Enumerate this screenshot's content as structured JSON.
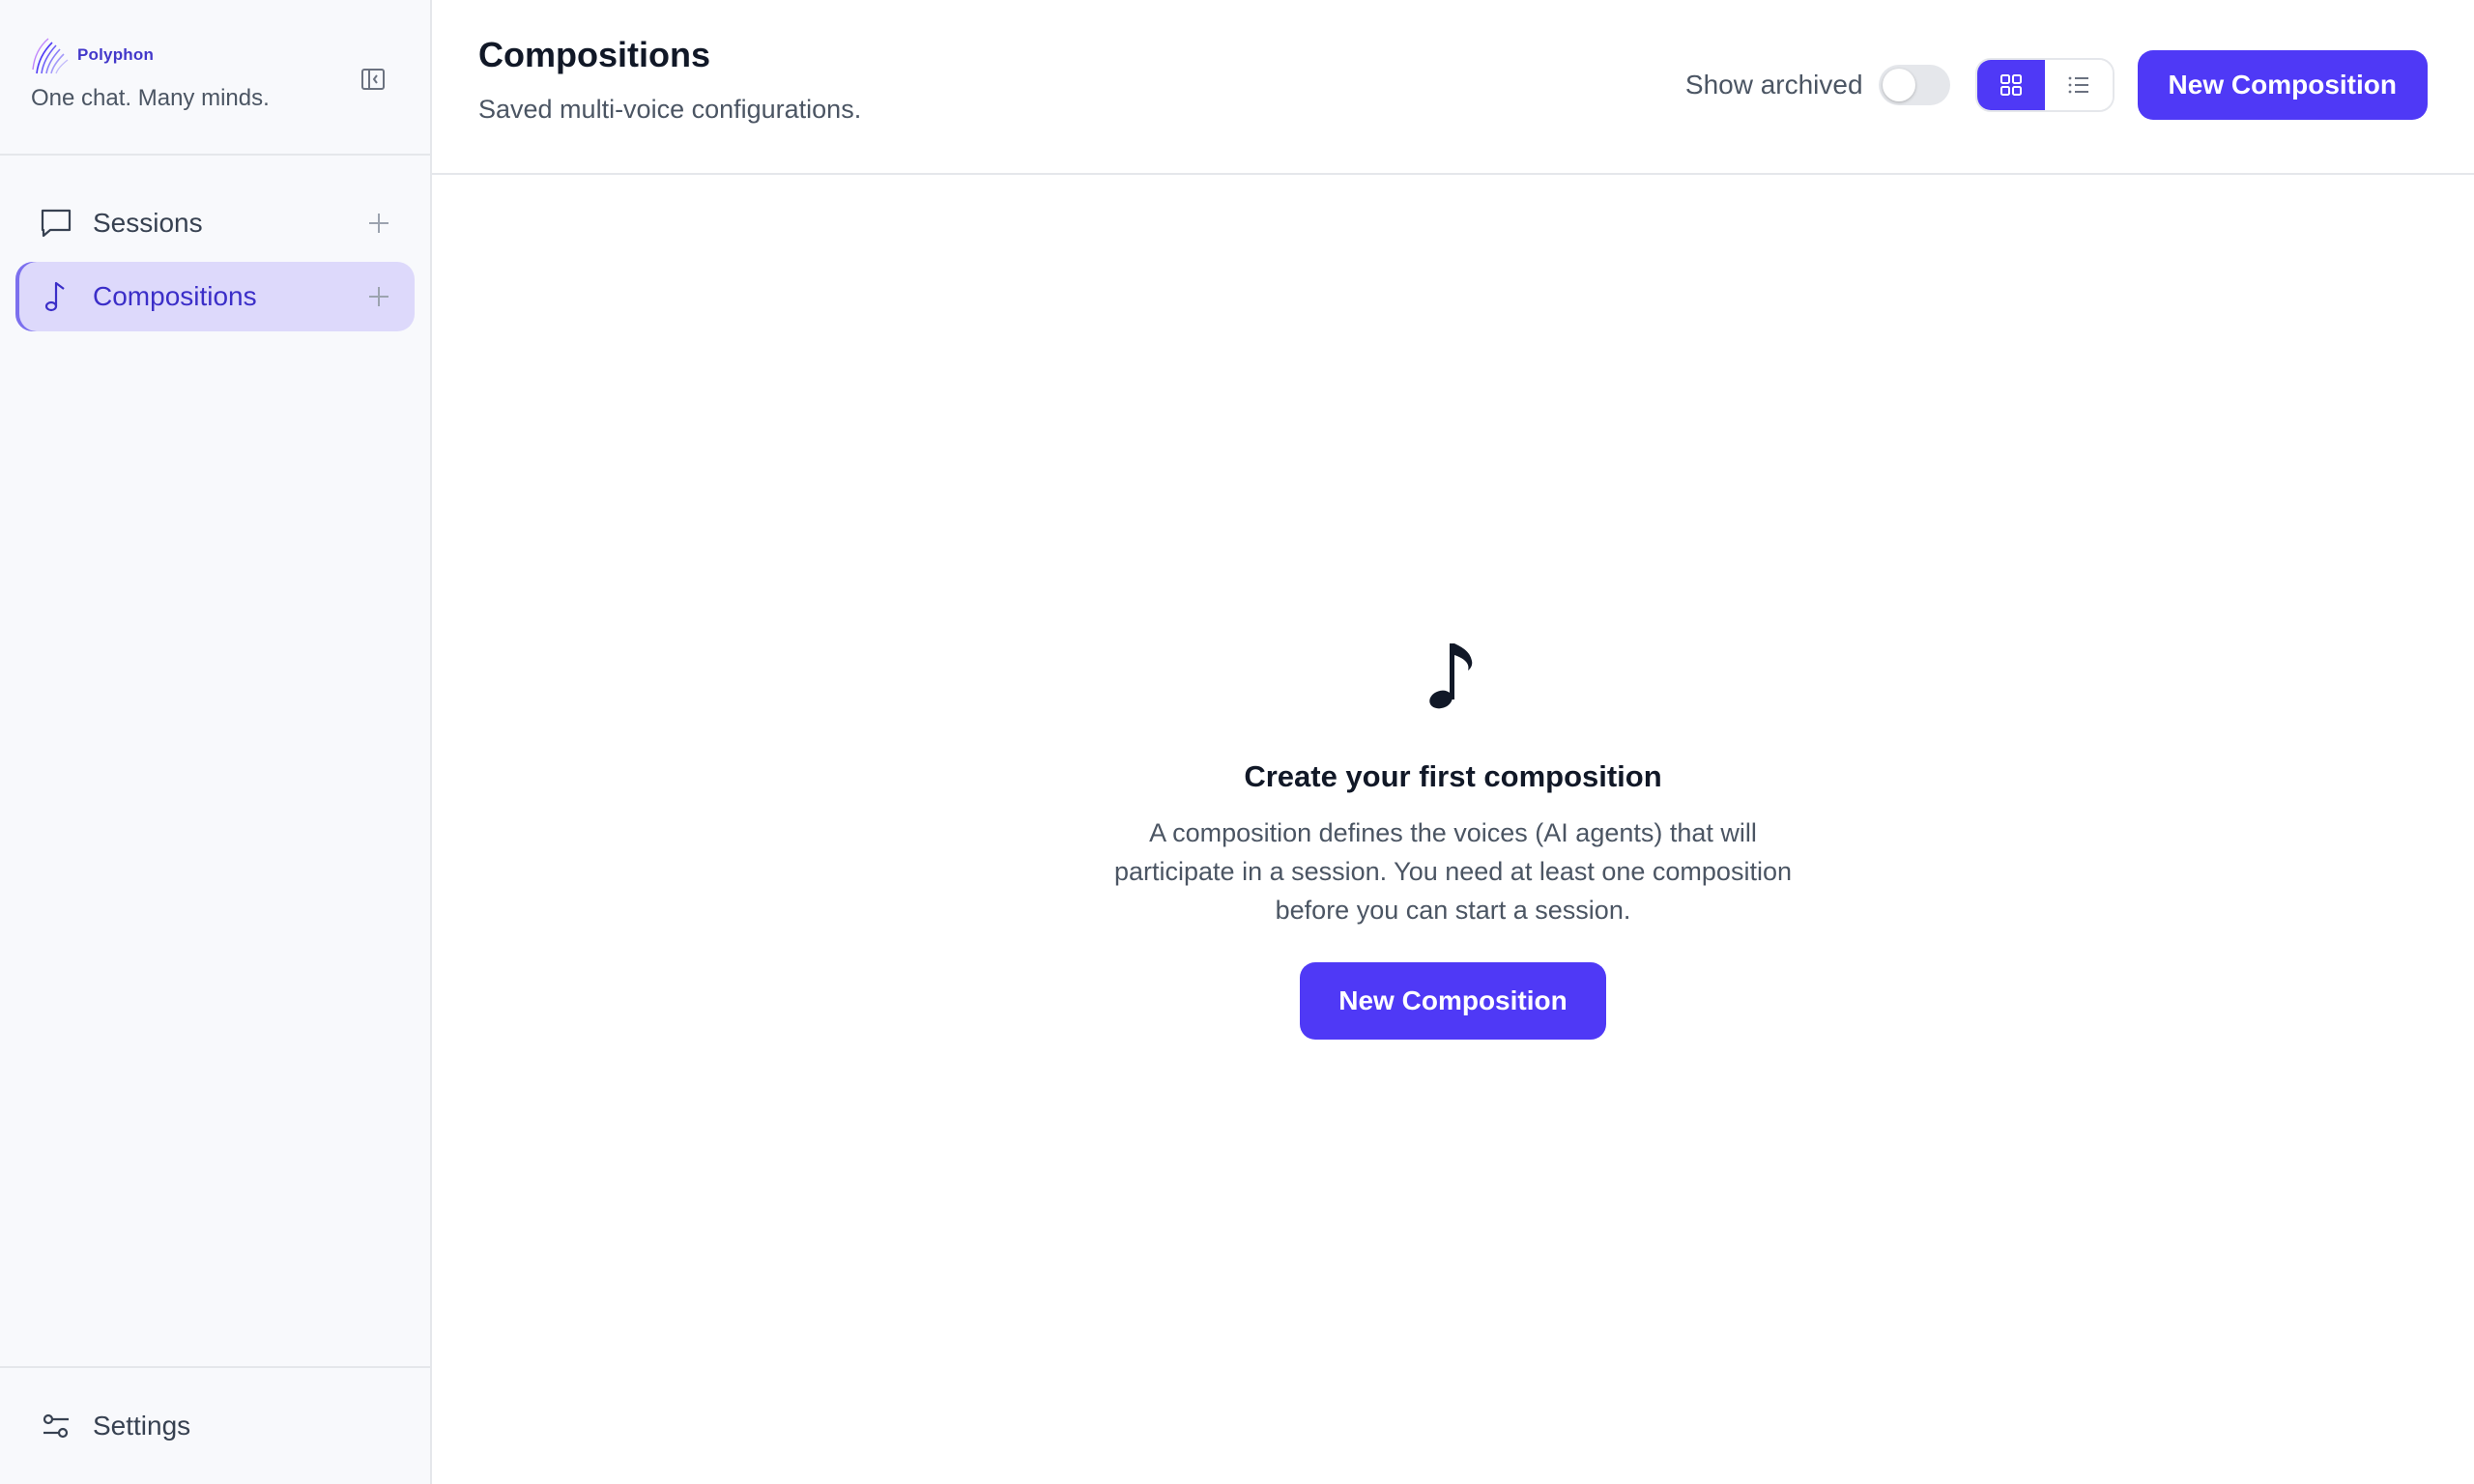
{
  "brand": {
    "name": "Polyphon",
    "tagline": "One chat. Many minds.",
    "accent": "#4f39f6"
  },
  "sidebar": {
    "items": [
      {
        "label": "Sessions",
        "icon": "chat-bubble-icon",
        "active": false
      },
      {
        "label": "Compositions",
        "icon": "music-note-icon",
        "active": true
      }
    ],
    "settings_label": "Settings"
  },
  "header": {
    "title": "Compositions",
    "subtitle": "Saved multi-voice configurations.",
    "show_archived_label": "Show archived",
    "show_archived": false,
    "view_mode": "grid",
    "new_button_label": "New Composition"
  },
  "empty_state": {
    "title": "Create your first composition",
    "description": "A composition defines the voices (AI agents) that will participate in a session. You need at least one composition before you can start a session.",
    "button_label": "New Composition"
  }
}
